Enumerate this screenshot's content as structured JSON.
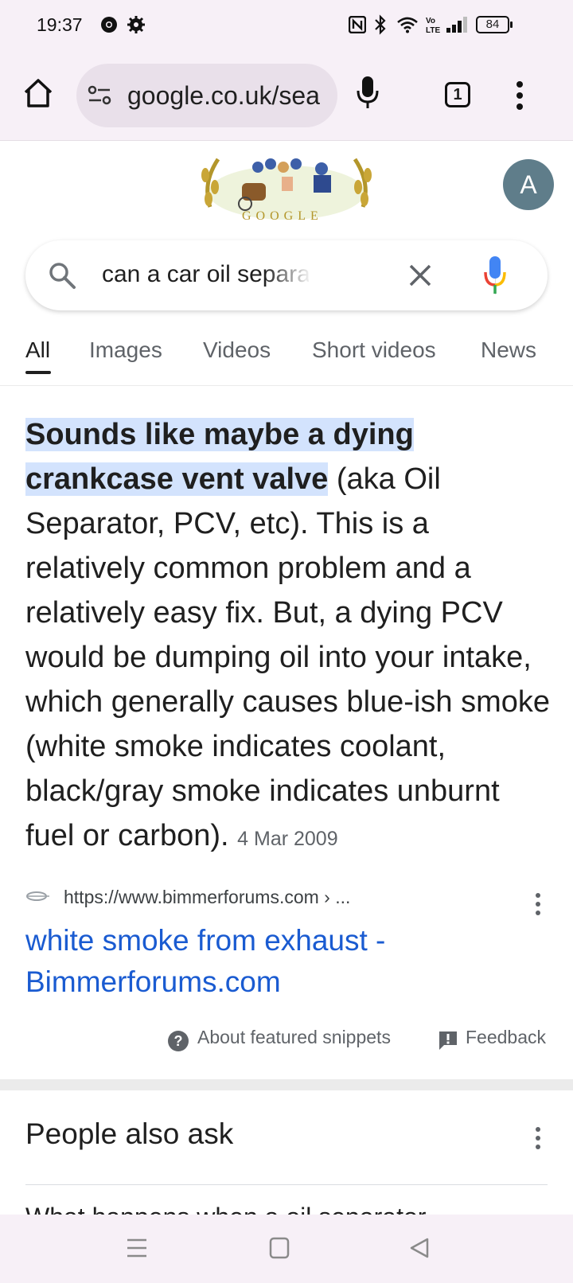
{
  "status_bar": {
    "time": "19:37",
    "battery": "84",
    "network": "Vo LTE"
  },
  "browser": {
    "url": "google.co.uk/sea",
    "tab_count": "1"
  },
  "account": {
    "avatar_letter": "A"
  },
  "doodle": {
    "text": "GOOGLE"
  },
  "search": {
    "query": "can a car oil separator cause white smoke"
  },
  "tabs": [
    {
      "label": "All"
    },
    {
      "label": "Images"
    },
    {
      "label": "Videos"
    },
    {
      "label": "Short videos"
    },
    {
      "label": "News"
    }
  ],
  "snippet": {
    "highlight": "Sounds like maybe a dying crankcase vent valve",
    "body": " (aka Oil Separator, PCV, etc). This is a relatively common problem and a relatively easy fix. But, a dying PCV would be dumping oil into your intake, which generally causes blue-ish smoke (white smoke indicates coolant, black/gray smoke indicates unburnt fuel or carbon). ",
    "date": "4 Mar 2009"
  },
  "source": {
    "url": "https://www.bimmerforums.com › ...",
    "title": "white smoke from exhaust - Bimmerforums.com"
  },
  "footer": {
    "about": "About featured snippets",
    "feedback": "Feedback"
  },
  "people_also_ask": {
    "title": "People also ask",
    "first_question": "What happens when a oil separator..."
  },
  "colors": {
    "link": "#1a5bd1",
    "highlight": "#d3e3fd",
    "chrome_bg": "#f7f0f7"
  }
}
